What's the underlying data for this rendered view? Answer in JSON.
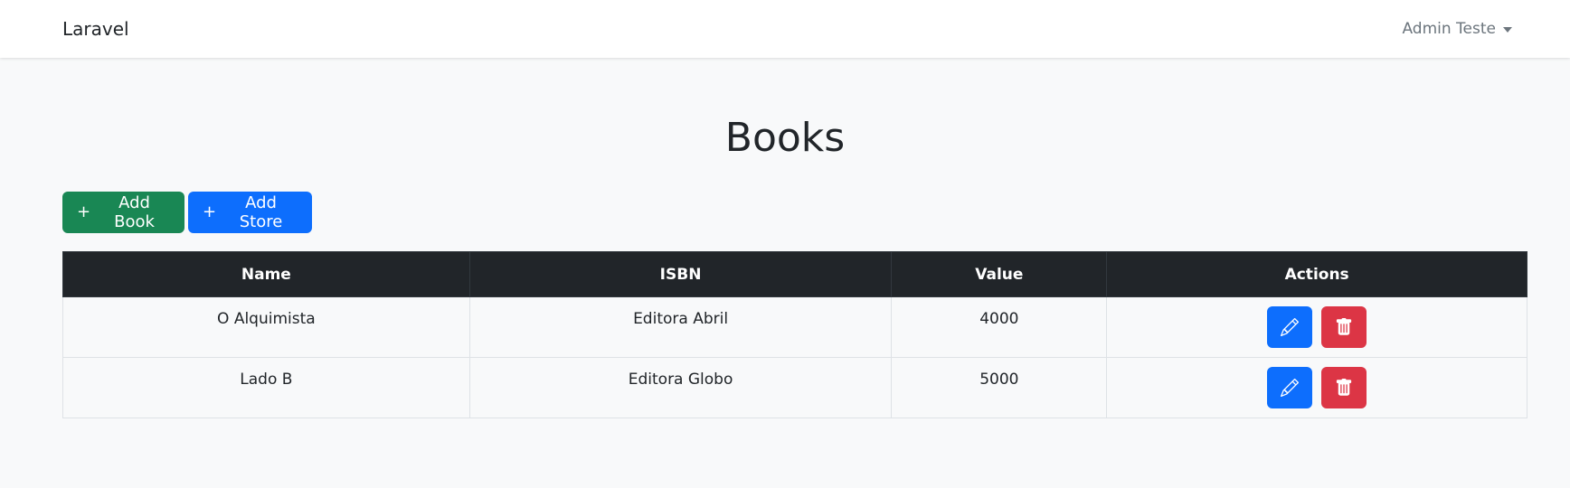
{
  "navbar": {
    "brand": "Laravel",
    "user_name": "Admin Teste"
  },
  "page": {
    "title": "Books"
  },
  "toolbar": {
    "add_book_icon": "+",
    "add_book_label": "Add Book",
    "add_store_icon": "+",
    "add_store_label": "Add Store"
  },
  "table": {
    "headers": {
      "name": "Name",
      "isbn": "ISBN",
      "value": "Value",
      "actions": "Actions"
    },
    "rows": [
      {
        "name": "O Alquimista",
        "isbn": "Editora Abril",
        "value": "4000"
      },
      {
        "name": "Lado B",
        "isbn": "Editora Globo",
        "value": "5000"
      }
    ],
    "row_actions": {
      "edit_icon": "pencil-icon",
      "delete_icon": "trash-icon"
    }
  },
  "colors": {
    "success": "#198754",
    "primary": "#0d6efd",
    "danger": "#dc3545",
    "table_header": "#212529",
    "background": "#f8f9fa"
  }
}
